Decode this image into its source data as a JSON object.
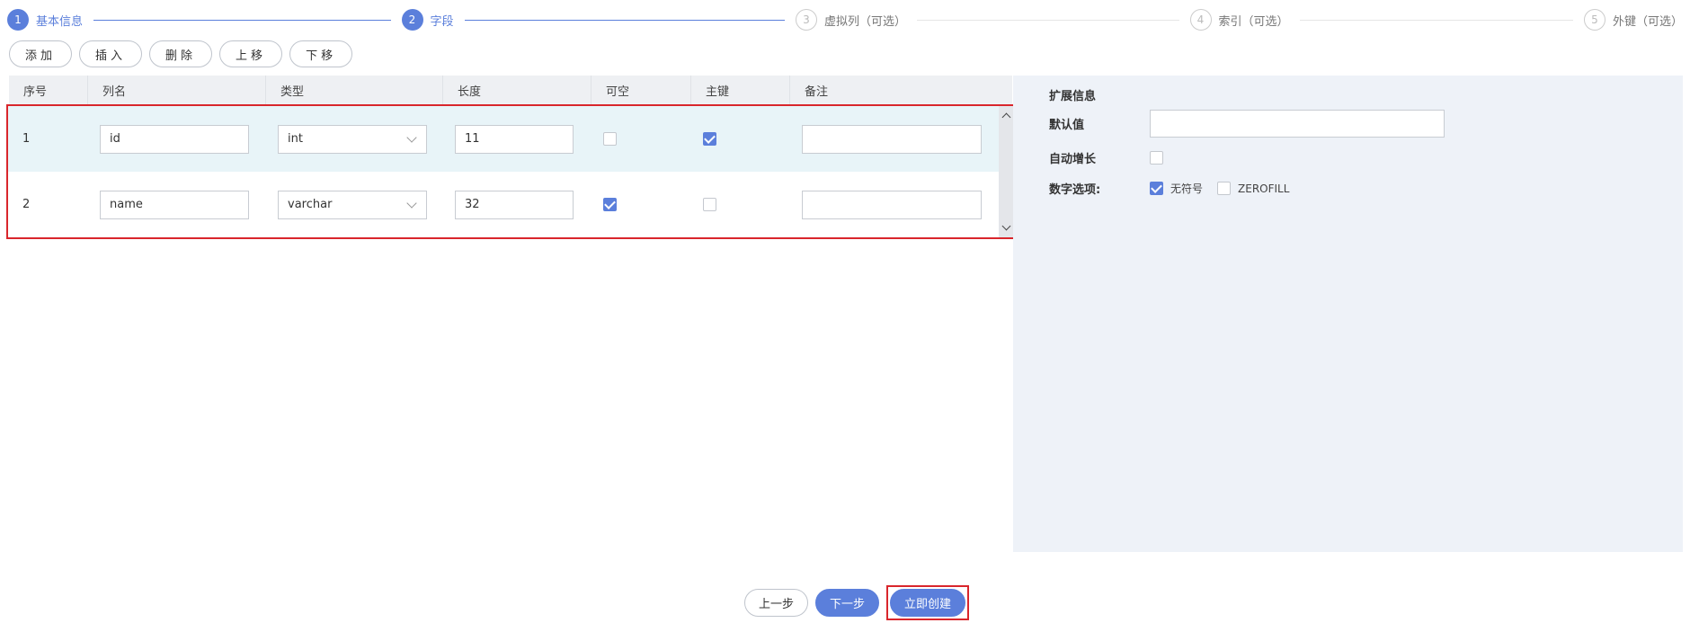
{
  "steps": [
    {
      "num": "1",
      "label": "基本信息",
      "state": "active"
    },
    {
      "num": "2",
      "label": "字段",
      "state": "active"
    },
    {
      "num": "3",
      "label": "虚拟列（可选）",
      "state": "inactive"
    },
    {
      "num": "4",
      "label": "索引（可选）",
      "state": "inactive"
    },
    {
      "num": "5",
      "label": "外键（可选）",
      "state": "inactive"
    }
  ],
  "toolbar": {
    "add": "添加",
    "insert": "插入",
    "delete": "删除",
    "move_up": "上移",
    "move_down": "下移"
  },
  "table": {
    "headers": [
      "序号",
      "列名",
      "类型",
      "长度",
      "可空",
      "主键",
      "备注"
    ],
    "rows": [
      {
        "seq": "1",
        "name": "id",
        "type": "int",
        "length": "11",
        "nullable": false,
        "primary_key": true,
        "note": "",
        "selected": true
      },
      {
        "seq": "2",
        "name": "name",
        "type": "varchar",
        "length": "32",
        "nullable": true,
        "primary_key": false,
        "note": "",
        "selected": false
      }
    ]
  },
  "extension": {
    "title": "扩展信息",
    "default_label": "默认值",
    "default_value": "",
    "auto_inc_label": "自动增长",
    "auto_inc": false,
    "numeric_label": "数字选项:",
    "unsigned_label": "无符号",
    "unsigned": true,
    "zerofill_label": "ZEROFILL",
    "zerofill": false
  },
  "footer": {
    "prev": "上一步",
    "next": "下一步",
    "create": "立即创建"
  },
  "colors": {
    "primary": "#5b7fdb",
    "highlight": "#d9262c"
  }
}
